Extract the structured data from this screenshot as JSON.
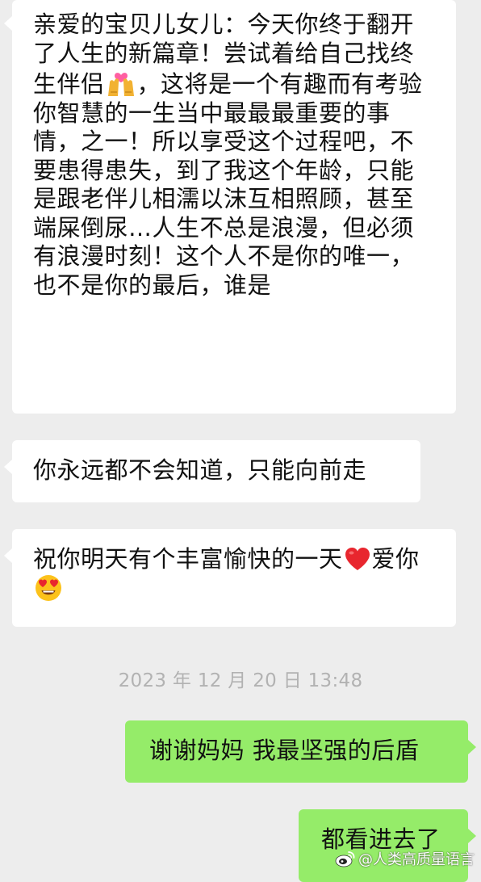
{
  "messages": [
    {
      "id": "msg1",
      "side": "left",
      "text_before_emoji": "亲爱的宝贝儿女儿：今天你终于翻开了人生的新篇章！尝试着给自己找终生伴侣",
      "emoji": "couple-with-heart-icon",
      "text_after_emoji": "，这将是一个有趣而有考验你智慧的一生当中最最最重要的事情，之一！所以享受这个过程吧，不要患得患失，到了我这个年龄，只能是跟老伴儿相濡以沫互相照顾，甚至端屎倒尿…人生不总是浪漫，但必须有浪漫时刻！这个人不是你的唯一，也不是你的最后，谁是"
    },
    {
      "id": "msg2",
      "side": "left",
      "text": "你永远都不会知道，只能向前走"
    },
    {
      "id": "msg3",
      "side": "left",
      "text_before_emoji": "祝你明天有个丰富愉快的一天",
      "emoji1": "red-heart-icon",
      "text_between": "爱你",
      "emoji2": "heart-eyes-face-icon"
    },
    {
      "id": "msg4",
      "side": "right",
      "text": "谢谢妈妈 我最坚强的后盾"
    },
    {
      "id": "msg5",
      "side": "right",
      "text": "都看进去了"
    }
  ],
  "timestamp": "2023 年 12 月 20 日  13:48",
  "watermark": {
    "logo": "weibo-logo-icon",
    "text": "@人类高质量语言"
  },
  "colors": {
    "background": "#ededed",
    "incoming_bubble": "#ffffff",
    "outgoing_bubble": "#95ec69",
    "timestamp_text": "#b2b2b2"
  }
}
